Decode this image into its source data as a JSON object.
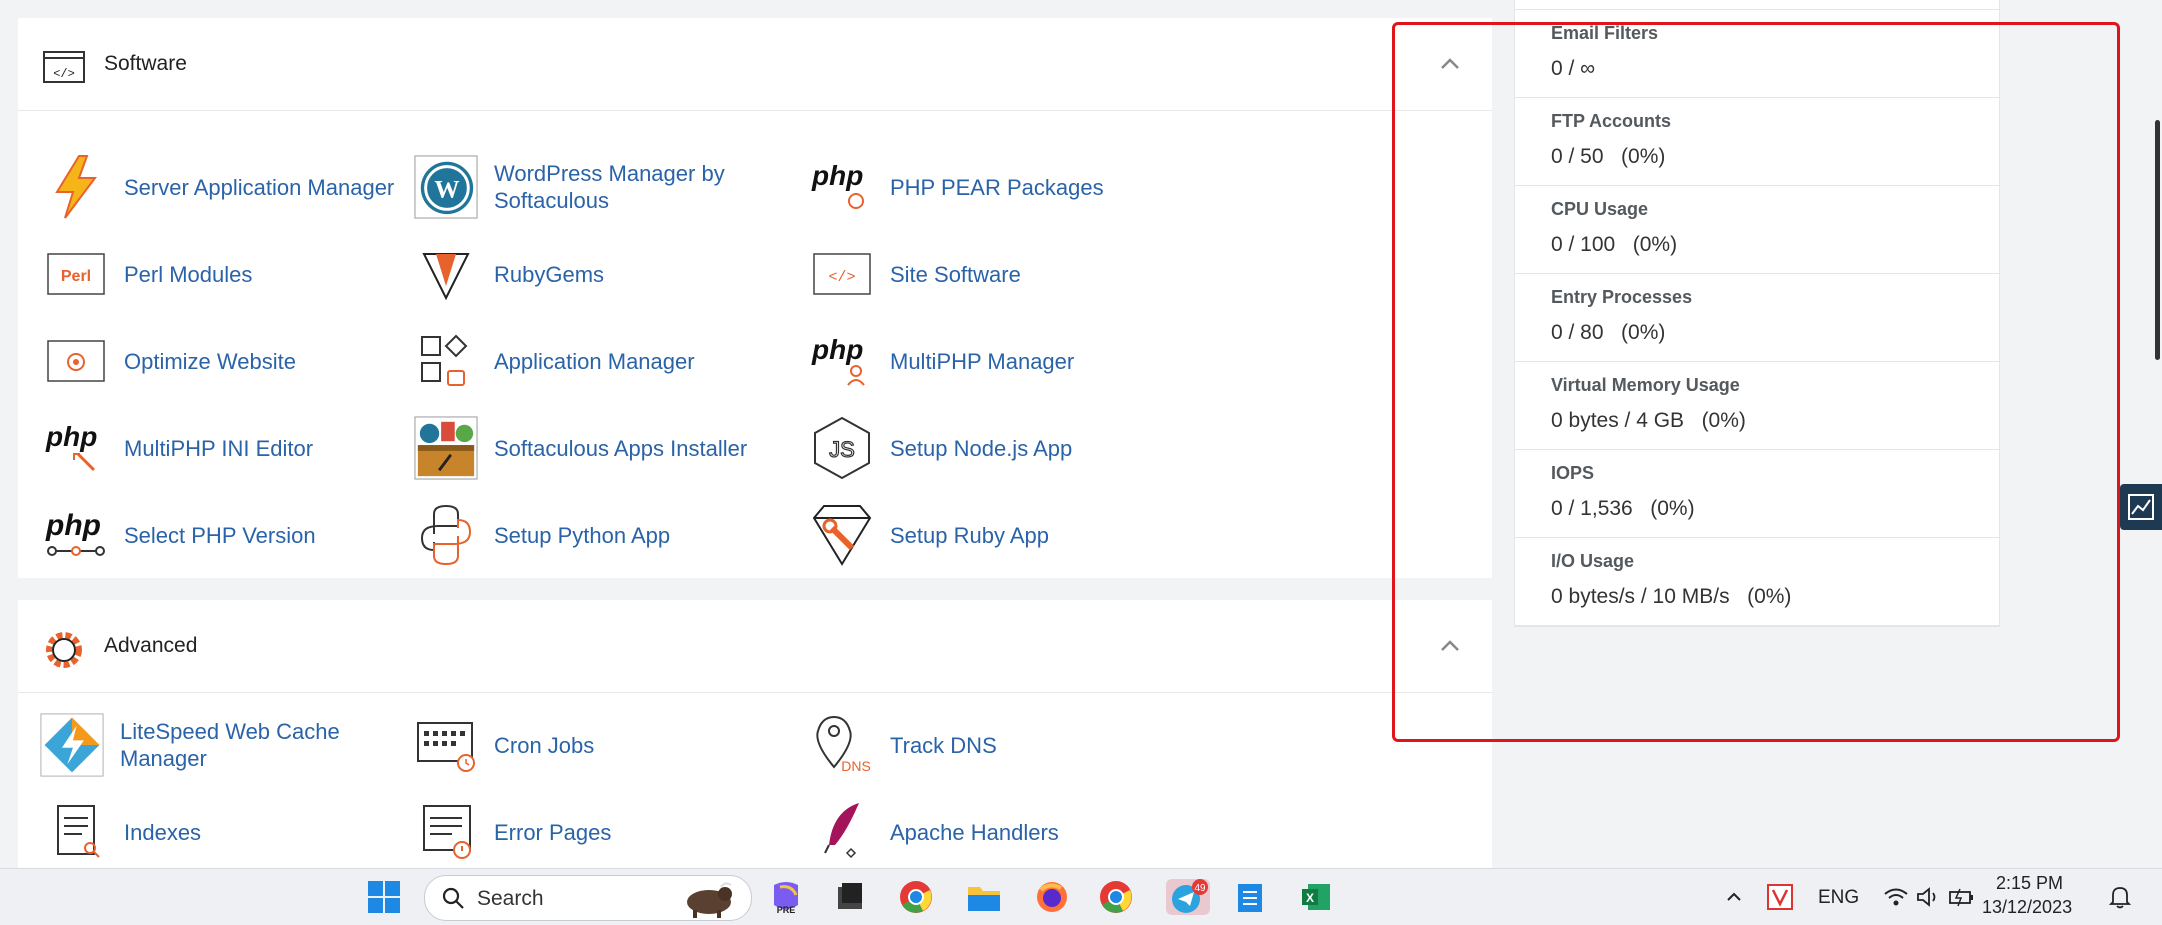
{
  "software": {
    "title": "Software",
    "items": [
      {
        "label": "Server Application Manager",
        "icon": "lightning-icon"
      },
      {
        "label": "WordPress Manager by Softaculous",
        "icon": "wordpress-icon"
      },
      {
        "label": "PHP PEAR Packages",
        "icon": "php-pear-icon"
      },
      {
        "label": "Perl Modules",
        "icon": "perl-icon"
      },
      {
        "label": "RubyGems",
        "icon": "ruby-gem-icon"
      },
      {
        "label": "Site Software",
        "icon": "code-window-icon"
      },
      {
        "label": "Optimize Website",
        "icon": "gear-window-icon"
      },
      {
        "label": "Application Manager",
        "icon": "app-grid-icon"
      },
      {
        "label": "MultiPHP Manager",
        "icon": "php-user-icon"
      },
      {
        "label": "MultiPHP INI Editor",
        "icon": "php-edit-icon"
      },
      {
        "label": "Softaculous Apps Installer",
        "icon": "softaculous-icon"
      },
      {
        "label": "Setup Node.js App",
        "icon": "nodejs-icon"
      },
      {
        "label": "Select PHP Version",
        "icon": "php-version-icon"
      },
      {
        "label": "Setup Python App",
        "icon": "python-icon"
      },
      {
        "label": "Setup Ruby App",
        "icon": "ruby-wrench-icon"
      }
    ],
    "icon_labels": {
      "perl": "Perl",
      "php": "php",
      "js": "JS",
      "code": "</>"
    }
  },
  "advanced": {
    "title": "Advanced",
    "items": [
      {
        "label": "LiteSpeed Web Cache Manager",
        "icon": "litespeed-icon"
      },
      {
        "label": "Cron Jobs",
        "icon": "calendar-clock-icon"
      },
      {
        "label": "Track DNS",
        "icon": "dns-pin-icon"
      },
      {
        "label": "Indexes",
        "icon": "document-search-icon"
      },
      {
        "label": "Error Pages",
        "icon": "error-page-icon"
      },
      {
        "label": "Apache Handlers",
        "icon": "feather-icon"
      }
    ],
    "icon_labels": {
      "dns": "DNS"
    }
  },
  "stats": [
    {
      "label": "Email Filters",
      "value": "0 / ∞"
    },
    {
      "label": "FTP Accounts",
      "value": "0 / 50   (0%)"
    },
    {
      "label": "CPU Usage",
      "value": "0 / 100   (0%)"
    },
    {
      "label": "Entry Processes",
      "value": "0 / 80   (0%)"
    },
    {
      "label": "Virtual Memory Usage",
      "value": "0 bytes / 4 GB   (0%)"
    },
    {
      "label": "IOPS",
      "value": "0 / 1,536   (0%)"
    },
    {
      "label": "I/O Usage",
      "value": "0 bytes/s / 10 MB/s   (0%)"
    }
  ],
  "taskbar": {
    "search_placeholder": "Search",
    "language": "ENG",
    "time": "2:15 PM",
    "date": "13/12/2023",
    "telegram_badge": "49",
    "copilot_badge": "PRE"
  },
  "colors": {
    "link": "#2a63a8",
    "accent": "#e8622c",
    "highlight_box": "#e0141b"
  }
}
